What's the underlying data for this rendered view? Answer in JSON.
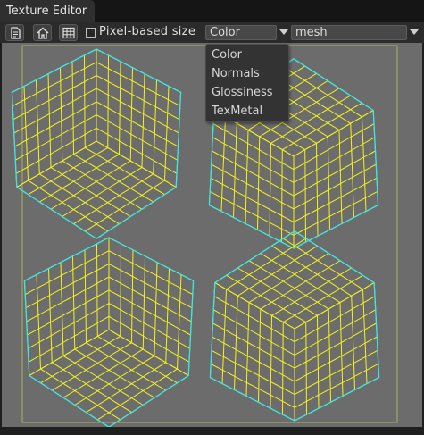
{
  "window": {
    "tab_title": "Texture Editor"
  },
  "toolbar": {
    "buttons": [
      "document-icon",
      "home-icon",
      "grid-icon"
    ],
    "pixel_size_checked": false,
    "pixel_size_label": "Pixel-based size",
    "channel_select_value": "Color",
    "mesh_select_value": "mesh"
  },
  "channel_dropdown": {
    "options": [
      "Color",
      "Normals",
      "Glossiness",
      "TexMetal"
    ]
  },
  "colors": {
    "uv_border": "#3fe3e3",
    "uv_grid": "#f2f21e",
    "viewport_bg": "#6c6c6c",
    "texture_bounds": "#a8b45a"
  }
}
